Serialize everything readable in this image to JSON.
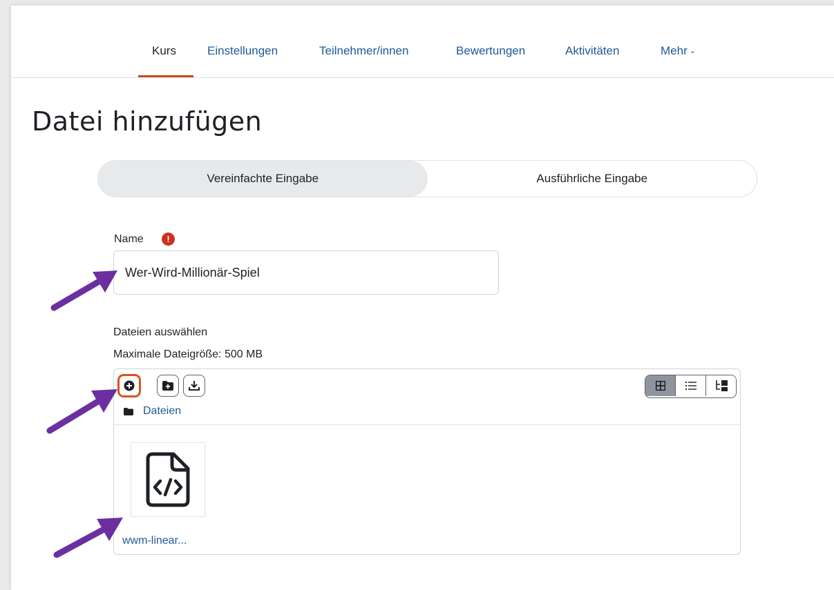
{
  "nav": {
    "tabs": [
      "Kurs",
      "Einstellungen",
      "Teilnehmer/innen",
      "Bewertungen",
      "Aktivitäten",
      "Mehr"
    ],
    "active_index": 0
  },
  "page": {
    "title": "Datei hinzufügen"
  },
  "mode_toggle": {
    "options": [
      "Vereinfachte Eingabe",
      "Ausführliche Eingabe"
    ],
    "selected_index": 0
  },
  "name_field": {
    "label": "Name",
    "value": "Wer-Wird-Millionär-Spiel",
    "required_icon": "exclamation-circle-icon"
  },
  "files": {
    "label": "Dateien auswählen",
    "max_size": "Maximale Dateigröße: 500 MB",
    "toolbar": [
      "add-file-icon",
      "create-folder-icon",
      "download-icon"
    ],
    "views": [
      "grid-view-icon",
      "list-view-icon",
      "tree-view-icon"
    ],
    "path_label": "Dateien",
    "items": [
      {
        "name": "wwm-linear...",
        "icon": "code-file-icon"
      }
    ]
  },
  "colors": {
    "accent": "#c14f16",
    "link": "#1e5a96",
    "required": "#ca3120",
    "annotation_arrow": "#6b2fa0"
  }
}
